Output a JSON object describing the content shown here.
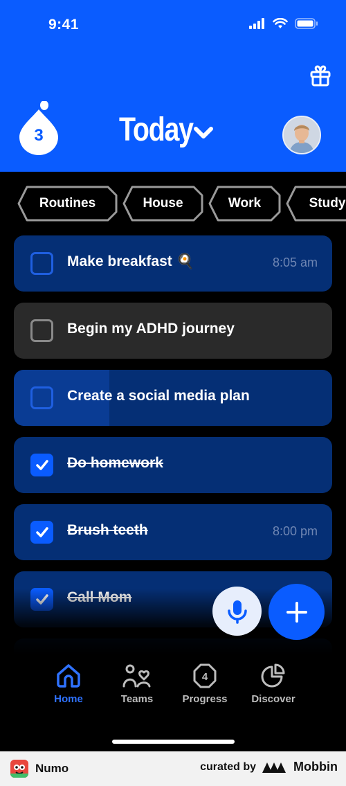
{
  "status_bar": {
    "time": "9:41"
  },
  "header": {
    "streak_count": "3",
    "title": "Today"
  },
  "filters": [
    {
      "label": "Routines"
    },
    {
      "label": "House"
    },
    {
      "label": "Work"
    },
    {
      "label": "Study"
    }
  ],
  "tasks": [
    {
      "label": "Make breakfast 🍳",
      "time": "8:05 am",
      "checked": false
    },
    {
      "label": "Begin my ADHD journey",
      "time": "",
      "checked": false
    },
    {
      "label": "Create a social media plan",
      "time": "",
      "checked": false,
      "progress": 0.3
    },
    {
      "label": "Do homework",
      "time": "",
      "checked": true
    },
    {
      "label": "Brush teeth",
      "time": "8:00 pm",
      "checked": true
    },
    {
      "label": "Call Mom",
      "time": "",
      "checked": true
    }
  ],
  "nav": [
    {
      "label": "Home",
      "icon": "home-icon",
      "active": true
    },
    {
      "label": "Teams",
      "icon": "teams-icon",
      "active": false
    },
    {
      "label": "Progress",
      "icon": "progress-icon",
      "active": false,
      "badge": "4"
    },
    {
      "label": "Discover",
      "icon": "discover-icon",
      "active": false
    }
  ],
  "footer": {
    "app_name": "Numo",
    "curated_by": "curated by",
    "brand": "Mobbin"
  },
  "colors": {
    "primary": "#0a5cff",
    "task_bg": "#052f75",
    "task_gray": "#2a2a2a"
  }
}
